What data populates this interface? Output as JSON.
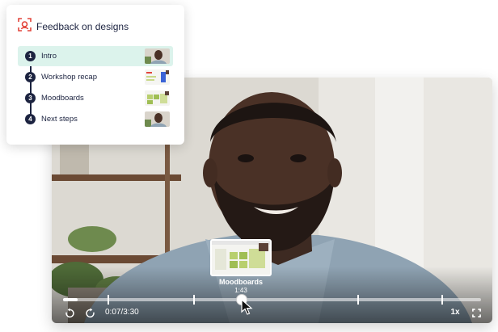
{
  "chapters_card": {
    "title": "Feedback on designs",
    "chapters": [
      {
        "number": "1",
        "label": "Intro",
        "active": true
      },
      {
        "number": "2",
        "label": "Workshop recap",
        "active": false
      },
      {
        "number": "3",
        "label": "Moodboards",
        "active": false
      },
      {
        "number": "4",
        "label": "Next steps",
        "active": false
      }
    ]
  },
  "player": {
    "current_time": "0:07/3:30",
    "speed": "1x",
    "progress_fraction": 0.034,
    "hover_preview": {
      "title": "Moodboards",
      "time": "1:43"
    }
  },
  "colors": {
    "accent": "#e3453b",
    "active_row": "#dcf3ec",
    "dark": "#1c2340"
  },
  "icons": {
    "title_icon": "feedback-camera-icon",
    "rewind": "rewind-icon",
    "forward": "forward-icon",
    "fullscreen": "fullscreen-icon",
    "cursor": "mouse-cursor-icon"
  }
}
